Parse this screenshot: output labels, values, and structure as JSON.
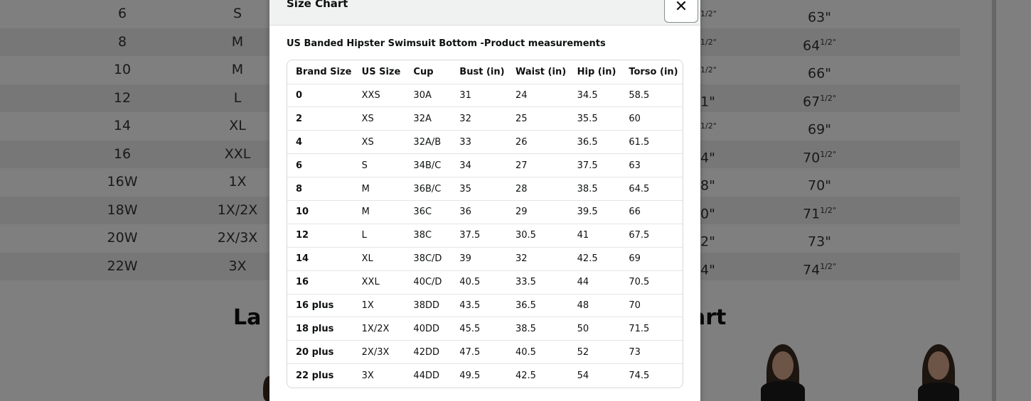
{
  "background": {
    "size_rows": [
      {
        "brand": "6",
        "us": "S",
        "mid": "",
        "mid_frac": "1/2\"",
        "torso": "63\"",
        "torso_frac": ""
      },
      {
        "brand": "8",
        "us": "M",
        "mid": "",
        "mid_frac": "1/2\"",
        "torso": "64",
        "torso_frac": "1/2\""
      },
      {
        "brand": "10",
        "us": "M",
        "mid": "",
        "mid_frac": "1/2\"",
        "torso": "66\"",
        "torso_frac": ""
      },
      {
        "brand": "12",
        "us": "L",
        "mid": "1\"",
        "mid_frac": "",
        "torso": "67",
        "torso_frac": "1/2\""
      },
      {
        "brand": "14",
        "us": "XL",
        "mid": "",
        "mid_frac": "1/2\"",
        "torso": "69\"",
        "torso_frac": ""
      },
      {
        "brand": "16",
        "us": "XXL",
        "mid": "4\"",
        "mid_frac": "",
        "torso": "70",
        "torso_frac": "1/2\""
      },
      {
        "brand": "16W",
        "us": "1X",
        "mid": "8\"",
        "mid_frac": "",
        "torso": "70\"",
        "torso_frac": ""
      },
      {
        "brand": "18W",
        "us": "1X/2X",
        "mid": "0\"",
        "mid_frac": "",
        "torso": "71",
        "torso_frac": "1/2\""
      },
      {
        "brand": "20W",
        "us": "2X/3X",
        "mid": "2\"",
        "mid_frac": "",
        "torso": "73\"",
        "torso_frac": ""
      },
      {
        "brand": "22W",
        "us": "3X",
        "mid": "4\"",
        "mid_frac": "",
        "torso": "74",
        "torso_frac": "1/2\""
      }
    ],
    "heading_left": "La I",
    "heading_right": "art"
  },
  "modal": {
    "title": "Size Chart",
    "close_label": "✕",
    "subtitle": "US Banded Hipster Swimsuit Bottom -Product measurements",
    "columns": [
      "Brand Size",
      "US Size",
      "Cup",
      "Bust (in)",
      "Waist (in)",
      "Hip (in)",
      "Torso (in)"
    ],
    "rows": [
      [
        "0",
        "XXS",
        "30A",
        "31",
        "24",
        "34.5",
        "58.5"
      ],
      [
        "2",
        "XS",
        "32A",
        "32",
        "25",
        "35.5",
        "60"
      ],
      [
        "4",
        "XS",
        "32A/B",
        "33",
        "26",
        "36.5",
        "61.5"
      ],
      [
        "6",
        "S",
        "34B/C",
        "34",
        "27",
        "37.5",
        "63"
      ],
      [
        "8",
        "M",
        "36B/C",
        "35",
        "28",
        "38.5",
        "64.5"
      ],
      [
        "10",
        "M",
        "36C",
        "36",
        "29",
        "39.5",
        "66"
      ],
      [
        "12",
        "L",
        "38C",
        "37.5",
        "30.5",
        "41",
        "67.5"
      ],
      [
        "14",
        "XL",
        "38C/D",
        "39",
        "32",
        "42.5",
        "69"
      ],
      [
        "16",
        "XXL",
        "40C/D",
        "40.5",
        "33.5",
        "44",
        "70.5"
      ],
      [
        "16 plus",
        "1X",
        "38DD",
        "43.5",
        "36.5",
        "48",
        "70"
      ],
      [
        "18 plus",
        "1X/2X",
        "40DD",
        "45.5",
        "38.5",
        "50",
        "71.5"
      ],
      [
        "20 plus",
        "2X/3X",
        "42DD",
        "47.5",
        "40.5",
        "52",
        "73"
      ],
      [
        "22 plus",
        "3X",
        "44DD",
        "49.5",
        "42.5",
        "54",
        "74.5"
      ]
    ]
  }
}
